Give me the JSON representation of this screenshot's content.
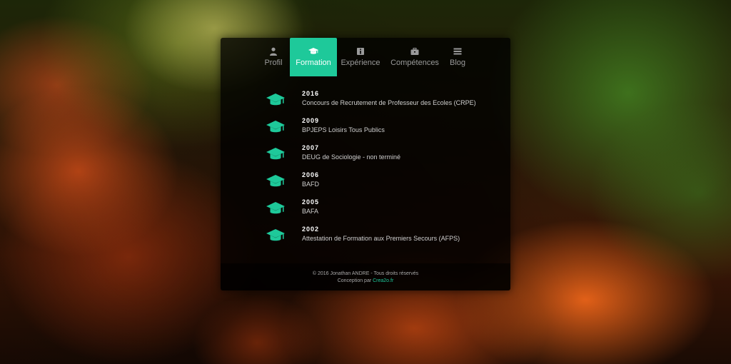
{
  "nav": {
    "tabs": [
      {
        "label": "Profil",
        "icon": "user-icon"
      },
      {
        "label": "Formation",
        "icon": "graduation-cap-icon",
        "active": true
      },
      {
        "label": "Expérience",
        "icon": "info-icon"
      },
      {
        "label": "Compétences",
        "icon": "briefcase-icon"
      },
      {
        "label": "Blog",
        "icon": "menu-icon"
      }
    ]
  },
  "formation": {
    "items": [
      {
        "year": "2016",
        "title": "Concours de Recrutement de Professeur des Ecoles (CRPE)"
      },
      {
        "year": "2009",
        "title": "BPJEPS Loisirs Tous Publics"
      },
      {
        "year": "2007",
        "title": "DEUG de Sociologie - non terminé"
      },
      {
        "year": "2006",
        "title": "BAFD"
      },
      {
        "year": "2005",
        "title": "BAFA"
      },
      {
        "year": "2002",
        "title": "Attestation de Formation aux Premiers Secours (AFPS)"
      }
    ]
  },
  "footer": {
    "copyright": "© 2016 Jonathan ANDRE - Tous droits réservés",
    "credit_prefix": "Conception par ",
    "credit_link": "Crea2o.fr"
  },
  "colors": {
    "accent": "#1ec99a",
    "panel_bg": "rgba(0,0,0,0.78)"
  }
}
